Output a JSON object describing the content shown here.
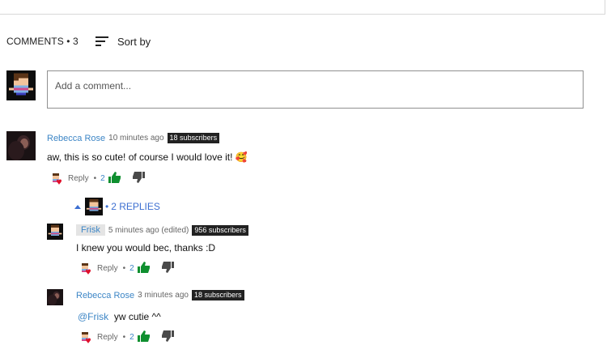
{
  "header": {
    "comments_label": "COMMENTS • 3",
    "sort_label": "Sort by"
  },
  "composer": {
    "placeholder": "Add a comment..."
  },
  "comments": [
    {
      "author": "Rebecca Rose",
      "time": "10 minutes ago",
      "subscribers": "18 subscribers",
      "text": "aw, this is so cute! of course I would love it! 🥰",
      "reply_label": "Reply",
      "likes": "2"
    }
  ],
  "replies_toggle": "2 REPLIES",
  "replies": [
    {
      "author": "Frisk",
      "time": "5 minutes ago (edited)",
      "subscribers": "956 subscribers",
      "text": "I knew you would bec, thanks :D",
      "reply_label": "Reply",
      "likes": "2"
    },
    {
      "author": "Rebecca Rose",
      "time": "3 minutes ago",
      "subscribers": "18 subscribers",
      "mention": "@Frisk",
      "text": "yw cutie ^^",
      "reply_label": "Reply",
      "likes": "2"
    }
  ],
  "colors": {
    "link": "#3d86c6",
    "like_green": "#0f8f2f",
    "badge_bg": "#222222"
  },
  "icons": [
    "sort-icon",
    "thumbs-up-icon",
    "thumbs-down-icon",
    "chevron-up-icon",
    "heart-icon"
  ]
}
